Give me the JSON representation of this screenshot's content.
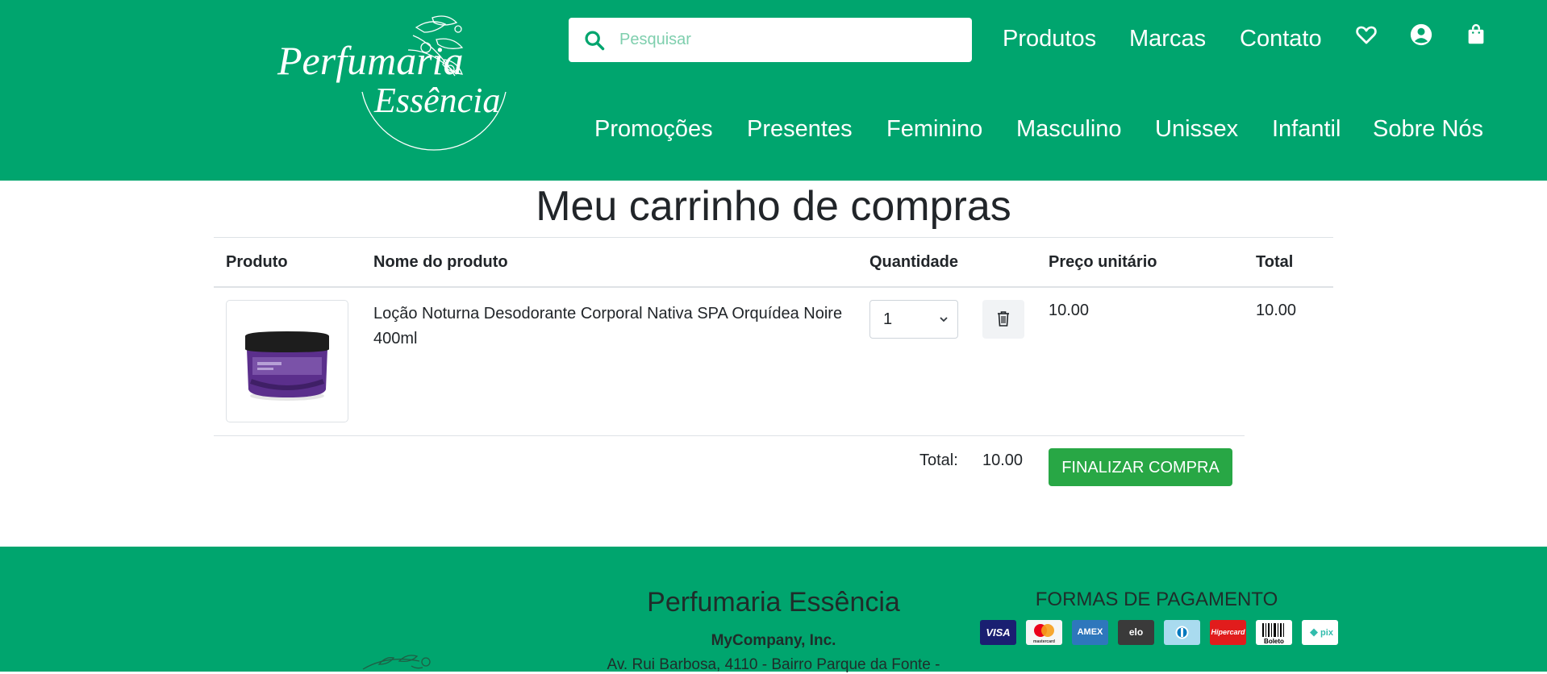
{
  "brand": {
    "logo_line1": "Perfumaria",
    "logo_line2": "Essência"
  },
  "search": {
    "placeholder": "Pesquisar"
  },
  "top_nav": [
    "Produtos",
    "Marcas",
    "Contato"
  ],
  "header_icons": [
    "heart-icon",
    "user-account-icon",
    "shopping-bag-icon"
  ],
  "category_nav": [
    "Promoções",
    "Presentes",
    "Feminino",
    "Masculino",
    "Unissex",
    "Infantil",
    "Sobre Nós"
  ],
  "cart": {
    "title": "Meu carrinho de compras",
    "columns": {
      "product": "Produto",
      "name": "Nome do produto",
      "quantity": "Quantidade",
      "unit_price": "Preço unitário",
      "total": "Total"
    },
    "items": [
      {
        "name": "Loção Noturna Desodorante Corporal Nativa SPA Orquídea Noire 400ml",
        "quantity": "1",
        "unit_price": "10.00",
        "total": "10.00"
      }
    ],
    "total_label": "Total:",
    "total_value": "10.00",
    "checkout_label": "FINALIZAR COMPRA"
  },
  "footer": {
    "title": "Perfumaria Essência",
    "company": "MyCompany, Inc.",
    "address": "Av. Rui Barbosa, 4110 - Bairro Parque da Fonte -",
    "payment_title": "FORMAS DE PAGAMENTO",
    "payment_methods": [
      "VISA",
      "mastercard",
      "AMEX",
      "elo",
      "diners",
      "Hipercard",
      "Boleto",
      "pix"
    ]
  },
  "colors": {
    "brand_green": "#00a56e",
    "button_green": "#28a745"
  }
}
